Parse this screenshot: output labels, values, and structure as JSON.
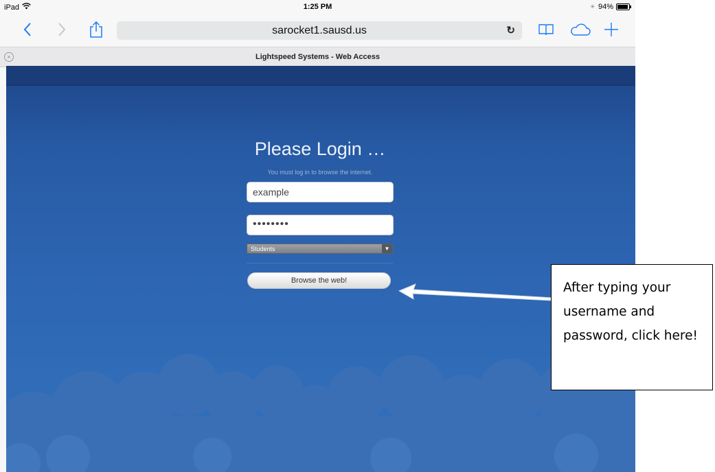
{
  "status_bar": {
    "device": "iPad",
    "time": "1:25 PM",
    "battery_percent": "94%",
    "battery_level": 0.94
  },
  "toolbar": {
    "url": "sarocket1.sausd.us",
    "icons": [
      "back-icon",
      "forward-icon",
      "share-icon",
      "reload-icon",
      "bookmarks-icon",
      "icloud-tabs-icon",
      "new-tab-icon"
    ]
  },
  "tab": {
    "title": "Lightspeed Systems - Web Access"
  },
  "login": {
    "heading": "Please Login …",
    "subtitle": "You must log in to browse the internet.",
    "username_value": "example",
    "password_masked": "••••••••",
    "group_selected": "Students",
    "submit_label": "Browse the web!"
  },
  "callout": {
    "text": "After typing your username and password, click here!"
  },
  "colors": {
    "ios_blue": "#1b7cf7",
    "page_blue": "#2d65b2",
    "cloud_blue": "#3b72b9"
  }
}
